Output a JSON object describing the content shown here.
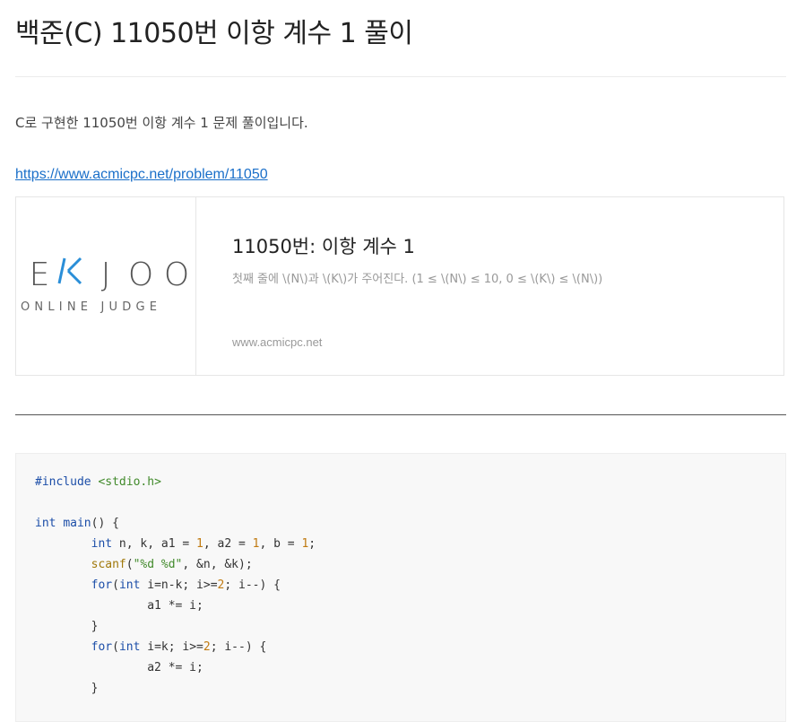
{
  "post": {
    "title": "백준(C) 11050번 이항 계수 1 풀이",
    "intro": "C로 구현한 11050번 이항 계수 1 문제 풀이입니다.",
    "link": "https://www.acmicpc.net/problem/11050"
  },
  "card": {
    "logo_main": [
      "E",
      "K",
      "J",
      "O",
      "O"
    ],
    "logo_sub": "ONLINE JUDGE",
    "title": "11050번: 이항 계수 1",
    "description": "첫째 줄에 \\(N\\)과 \\(K\\)가 주어진다. (1 ≤ \\(N\\) ≤ 10, 0 ≤ \\(K\\) ≤ \\(N\\))",
    "domain": "www.acmicpc.net"
  },
  "colors": {
    "link": "#1a6fc9",
    "logo_accent": "#2a8ed8"
  },
  "code": {
    "lines": [
      [
        {
          "t": "pp",
          "v": "#include"
        },
        {
          "t": "plain",
          "v": " "
        },
        {
          "t": "inc",
          "v": "<stdio.h>"
        }
      ],
      [],
      [
        {
          "t": "kw",
          "v": "int"
        },
        {
          "t": "plain",
          "v": " "
        },
        {
          "t": "fn",
          "v": "main"
        },
        {
          "t": "plain",
          "v": "() {"
        }
      ],
      [
        {
          "t": "plain",
          "v": "        "
        },
        {
          "t": "kw",
          "v": "int"
        },
        {
          "t": "plain",
          "v": " n, k, a1 = "
        },
        {
          "t": "num",
          "v": "1"
        },
        {
          "t": "plain",
          "v": ", a2 = "
        },
        {
          "t": "num",
          "v": "1"
        },
        {
          "t": "plain",
          "v": ", b = "
        },
        {
          "t": "num",
          "v": "1"
        },
        {
          "t": "plain",
          "v": ";"
        }
      ],
      [
        {
          "t": "plain",
          "v": "        "
        },
        {
          "t": "call",
          "v": "scanf"
        },
        {
          "t": "plain",
          "v": "("
        },
        {
          "t": "str",
          "v": "\"%d %d\""
        },
        {
          "t": "plain",
          "v": ", &n, &k);"
        }
      ],
      [
        {
          "t": "plain",
          "v": "        "
        },
        {
          "t": "kw",
          "v": "for"
        },
        {
          "t": "plain",
          "v": "("
        },
        {
          "t": "kw",
          "v": "int"
        },
        {
          "t": "plain",
          "v": " i=n-k; i>="
        },
        {
          "t": "num",
          "v": "2"
        },
        {
          "t": "plain",
          "v": "; i--) {"
        }
      ],
      [
        {
          "t": "plain",
          "v": "                a1 *= i;"
        }
      ],
      [
        {
          "t": "plain",
          "v": "        }"
        }
      ],
      [
        {
          "t": "plain",
          "v": "        "
        },
        {
          "t": "kw",
          "v": "for"
        },
        {
          "t": "plain",
          "v": "("
        },
        {
          "t": "kw",
          "v": "int"
        },
        {
          "t": "plain",
          "v": " i=k; i>="
        },
        {
          "t": "num",
          "v": "2"
        },
        {
          "t": "plain",
          "v": "; i--) {"
        }
      ],
      [
        {
          "t": "plain",
          "v": "                a2 *= i;"
        }
      ],
      [
        {
          "t": "plain",
          "v": "        }"
        }
      ]
    ]
  }
}
